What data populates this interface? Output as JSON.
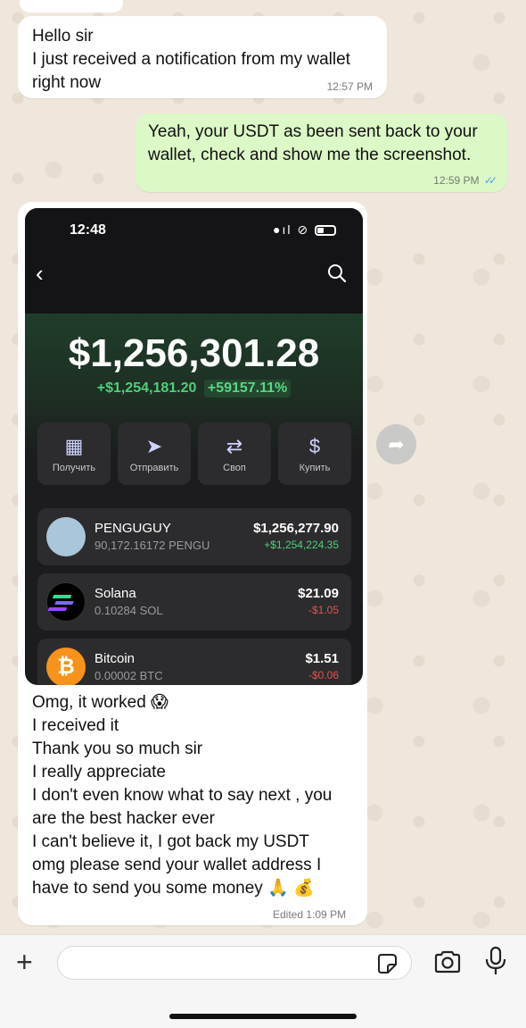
{
  "messages": {
    "m1": {
      "lines": [
        "Hello sir",
        "I just received a notification from my wallet",
        "right now"
      ],
      "time": "12:57 PM"
    },
    "m2": {
      "lines": [
        "Yeah, your USDT as been sent back to your",
        "wallet, check and show me the screenshot."
      ],
      "time": "12:59 PM",
      "ticks": "✓✓"
    },
    "m3": {
      "lines": [
        "Omg,  it worked 😱",
        "I received it",
        "Thank you so much sir",
        "I really appreciate",
        "I don't even know what to say next , you",
        "are the best hacker ever",
        "I can't believe it, I got back my USDT",
        "omg please send your wallet address I",
        "have to send you some money 🙏 💰"
      ],
      "edited": "Edited",
      "time": "1:09 PM"
    }
  },
  "wallet_screenshot": {
    "status_time": "12:48",
    "balance": "$1,256,301.28",
    "change": "+$1,254,181.20",
    "change_pct": "+59157.11%",
    "actions": [
      {
        "label": "Получить",
        "icon": "qr-icon"
      },
      {
        "label": "Отправить",
        "icon": "send-icon"
      },
      {
        "label": "Своп",
        "icon": "swap-icon"
      },
      {
        "label": "Купить",
        "icon": "dollar-icon"
      }
    ],
    "assets": [
      {
        "name": "PENGUGUY",
        "amount": "90,172.16172 PENGU",
        "value": "$1,256,277.90",
        "change": "+$1,254,224.35",
        "trend": "positive"
      },
      {
        "name": "Solana",
        "amount": "0.10284 SOL",
        "value": "$21.09",
        "change": "-$1.05",
        "trend": "negative"
      },
      {
        "name": "Bitcoin",
        "amount": "0.00002 BTC",
        "value": "$1.51",
        "change": "-$0.06",
        "trend": "negative"
      }
    ]
  },
  "colors": {
    "incoming_bubble": "#ffffff",
    "outgoing_bubble": "#dcf8c6",
    "read_ticks": "#4fa3e0",
    "positive": "#4ed07a",
    "negative": "#e55050"
  },
  "icons": {
    "forward": "forward-icon",
    "attach": "plus-icon",
    "sticker": "sticker-icon",
    "camera": "camera-icon",
    "microphone": "microphone-icon"
  }
}
